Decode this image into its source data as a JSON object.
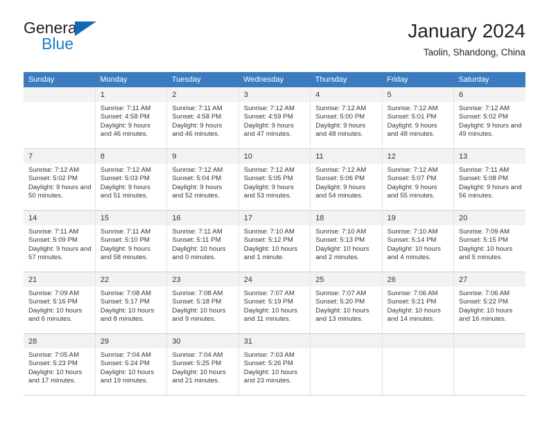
{
  "brand": {
    "name_top": "General",
    "name_bottom": "Blue",
    "triangle_color": "#1568b3",
    "blue_text_color": "#1b7cc4"
  },
  "header": {
    "title": "January 2024",
    "location": "Taolin, Shandong, China"
  },
  "calendar": {
    "header_bg": "#3a7cbf",
    "header_text_color": "#ffffff",
    "weekday_headers": [
      "Sunday",
      "Monday",
      "Tuesday",
      "Wednesday",
      "Thursday",
      "Friday",
      "Saturday"
    ],
    "labels": {
      "sunrise": "Sunrise:",
      "sunset": "Sunset:",
      "daylight": "Daylight:"
    },
    "weeks": [
      [
        {
          "day": "",
          "sunrise": "",
          "sunset": "",
          "daylight": ""
        },
        {
          "day": "1",
          "sunrise": "Sunrise: 7:11 AM",
          "sunset": "Sunset: 4:58 PM",
          "daylight": "Daylight: 9 hours and 46 minutes."
        },
        {
          "day": "2",
          "sunrise": "Sunrise: 7:11 AM",
          "sunset": "Sunset: 4:58 PM",
          "daylight": "Daylight: 9 hours and 46 minutes."
        },
        {
          "day": "3",
          "sunrise": "Sunrise: 7:12 AM",
          "sunset": "Sunset: 4:59 PM",
          "daylight": "Daylight: 9 hours and 47 minutes."
        },
        {
          "day": "4",
          "sunrise": "Sunrise: 7:12 AM",
          "sunset": "Sunset: 5:00 PM",
          "daylight": "Daylight: 9 hours and 48 minutes."
        },
        {
          "day": "5",
          "sunrise": "Sunrise: 7:12 AM",
          "sunset": "Sunset: 5:01 PM",
          "daylight": "Daylight: 9 hours and 48 minutes."
        },
        {
          "day": "6",
          "sunrise": "Sunrise: 7:12 AM",
          "sunset": "Sunset: 5:02 PM",
          "daylight": "Daylight: 9 hours and 49 minutes."
        }
      ],
      [
        {
          "day": "7",
          "sunrise": "Sunrise: 7:12 AM",
          "sunset": "Sunset: 5:02 PM",
          "daylight": "Daylight: 9 hours and 50 minutes."
        },
        {
          "day": "8",
          "sunrise": "Sunrise: 7:12 AM",
          "sunset": "Sunset: 5:03 PM",
          "daylight": "Daylight: 9 hours and 51 minutes."
        },
        {
          "day": "9",
          "sunrise": "Sunrise: 7:12 AM",
          "sunset": "Sunset: 5:04 PM",
          "daylight": "Daylight: 9 hours and 52 minutes."
        },
        {
          "day": "10",
          "sunrise": "Sunrise: 7:12 AM",
          "sunset": "Sunset: 5:05 PM",
          "daylight": "Daylight: 9 hours and 53 minutes."
        },
        {
          "day": "11",
          "sunrise": "Sunrise: 7:12 AM",
          "sunset": "Sunset: 5:06 PM",
          "daylight": "Daylight: 9 hours and 54 minutes."
        },
        {
          "day": "12",
          "sunrise": "Sunrise: 7:12 AM",
          "sunset": "Sunset: 5:07 PM",
          "daylight": "Daylight: 9 hours and 55 minutes."
        },
        {
          "day": "13",
          "sunrise": "Sunrise: 7:11 AM",
          "sunset": "Sunset: 5:08 PM",
          "daylight": "Daylight: 9 hours and 56 minutes."
        }
      ],
      [
        {
          "day": "14",
          "sunrise": "Sunrise: 7:11 AM",
          "sunset": "Sunset: 5:09 PM",
          "daylight": "Daylight: 9 hours and 57 minutes."
        },
        {
          "day": "15",
          "sunrise": "Sunrise: 7:11 AM",
          "sunset": "Sunset: 5:10 PM",
          "daylight": "Daylight: 9 hours and 58 minutes."
        },
        {
          "day": "16",
          "sunrise": "Sunrise: 7:11 AM",
          "sunset": "Sunset: 5:11 PM",
          "daylight": "Daylight: 10 hours and 0 minutes."
        },
        {
          "day": "17",
          "sunrise": "Sunrise: 7:10 AM",
          "sunset": "Sunset: 5:12 PM",
          "daylight": "Daylight: 10 hours and 1 minute."
        },
        {
          "day": "18",
          "sunrise": "Sunrise: 7:10 AM",
          "sunset": "Sunset: 5:13 PM",
          "daylight": "Daylight: 10 hours and 2 minutes."
        },
        {
          "day": "19",
          "sunrise": "Sunrise: 7:10 AM",
          "sunset": "Sunset: 5:14 PM",
          "daylight": "Daylight: 10 hours and 4 minutes."
        },
        {
          "day": "20",
          "sunrise": "Sunrise: 7:09 AM",
          "sunset": "Sunset: 5:15 PM",
          "daylight": "Daylight: 10 hours and 5 minutes."
        }
      ],
      [
        {
          "day": "21",
          "sunrise": "Sunrise: 7:09 AM",
          "sunset": "Sunset: 5:16 PM",
          "daylight": "Daylight: 10 hours and 6 minutes."
        },
        {
          "day": "22",
          "sunrise": "Sunrise: 7:08 AM",
          "sunset": "Sunset: 5:17 PM",
          "daylight": "Daylight: 10 hours and 8 minutes."
        },
        {
          "day": "23",
          "sunrise": "Sunrise: 7:08 AM",
          "sunset": "Sunset: 5:18 PM",
          "daylight": "Daylight: 10 hours and 9 minutes."
        },
        {
          "day": "24",
          "sunrise": "Sunrise: 7:07 AM",
          "sunset": "Sunset: 5:19 PM",
          "daylight": "Daylight: 10 hours and 11 minutes."
        },
        {
          "day": "25",
          "sunrise": "Sunrise: 7:07 AM",
          "sunset": "Sunset: 5:20 PM",
          "daylight": "Daylight: 10 hours and 13 minutes."
        },
        {
          "day": "26",
          "sunrise": "Sunrise: 7:06 AM",
          "sunset": "Sunset: 5:21 PM",
          "daylight": "Daylight: 10 hours and 14 minutes."
        },
        {
          "day": "27",
          "sunrise": "Sunrise: 7:06 AM",
          "sunset": "Sunset: 5:22 PM",
          "daylight": "Daylight: 10 hours and 16 minutes."
        }
      ],
      [
        {
          "day": "28",
          "sunrise": "Sunrise: 7:05 AM",
          "sunset": "Sunset: 5:23 PM",
          "daylight": "Daylight: 10 hours and 17 minutes."
        },
        {
          "day": "29",
          "sunrise": "Sunrise: 7:04 AM",
          "sunset": "Sunset: 5:24 PM",
          "daylight": "Daylight: 10 hours and 19 minutes."
        },
        {
          "day": "30",
          "sunrise": "Sunrise: 7:04 AM",
          "sunset": "Sunset: 5:25 PM",
          "daylight": "Daylight: 10 hours and 21 minutes."
        },
        {
          "day": "31",
          "sunrise": "Sunrise: 7:03 AM",
          "sunset": "Sunset: 5:26 PM",
          "daylight": "Daylight: 10 hours and 23 minutes."
        },
        {
          "day": "",
          "sunrise": "",
          "sunset": "",
          "daylight": ""
        },
        {
          "day": "",
          "sunrise": "",
          "sunset": "",
          "daylight": ""
        },
        {
          "day": "",
          "sunrise": "",
          "sunset": "",
          "daylight": ""
        }
      ]
    ]
  }
}
